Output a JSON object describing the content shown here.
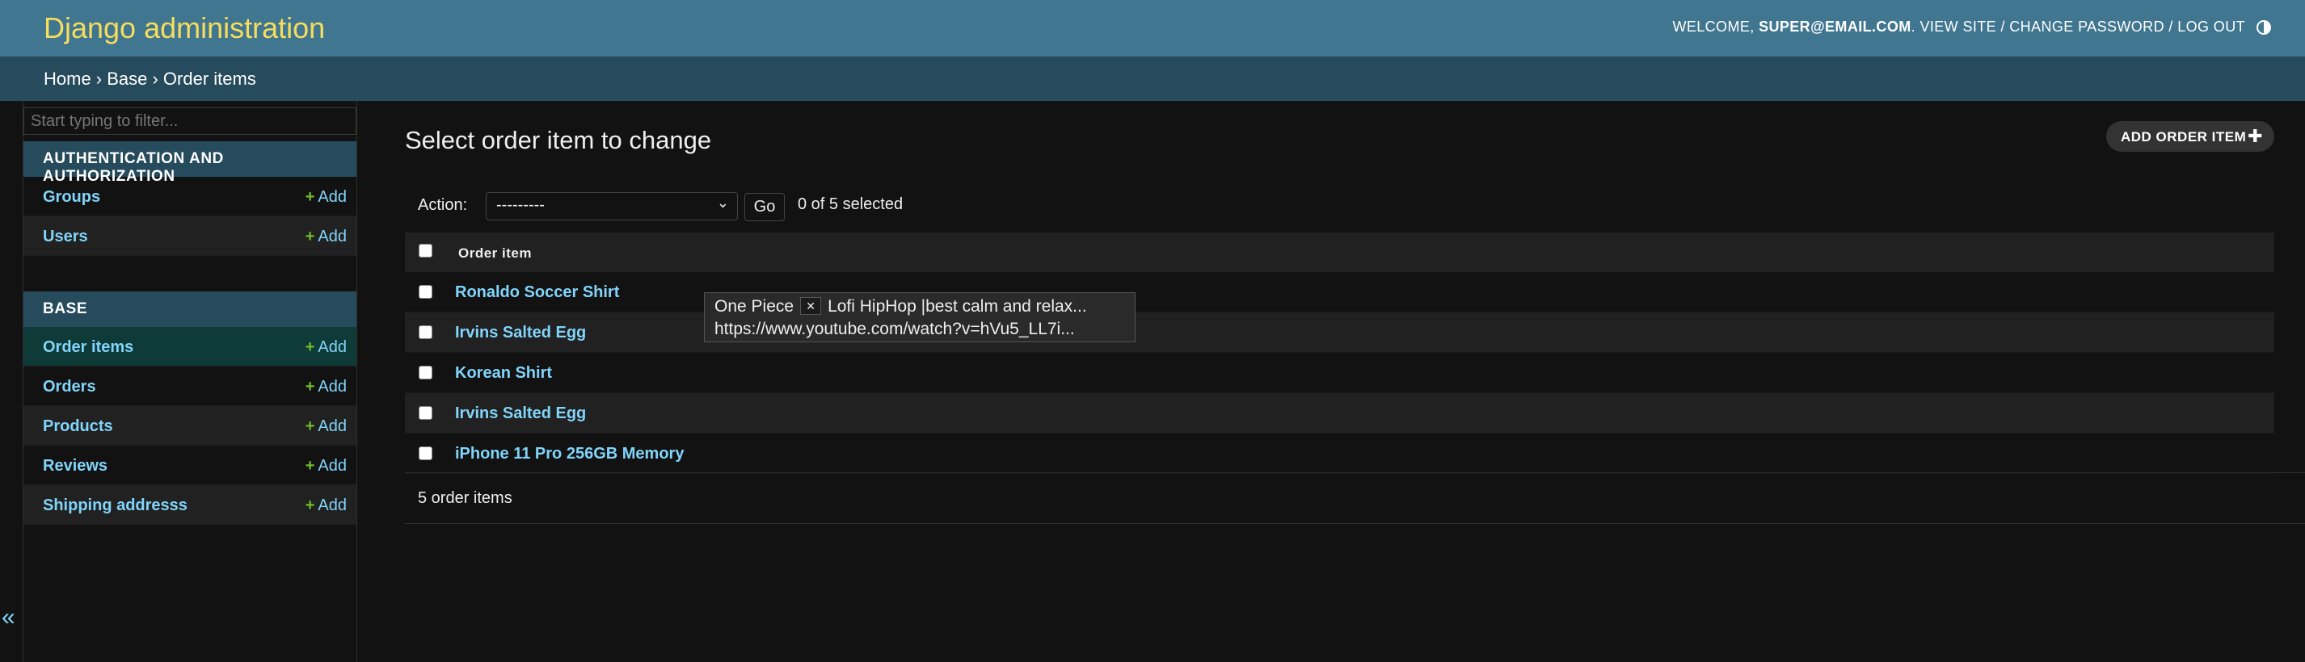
{
  "header": {
    "site_title": "Django administration",
    "welcome": "Welcome,",
    "user_email": "super@email.com",
    "links": [
      "View site",
      "Change password",
      "Log out"
    ],
    "separator": "/"
  },
  "breadcrumbs": {
    "text": "Home › Base › Order items"
  },
  "sidebar": {
    "filter_placeholder": "Start typing to filter...",
    "modules": [
      {
        "caption": "Authentication and Authorization",
        "models": [
          {
            "name": "Groups",
            "add": "Add"
          },
          {
            "name": "Users",
            "add": "Add"
          }
        ]
      },
      {
        "caption": "Base",
        "models": [
          {
            "name": "Order items",
            "add": "Add"
          },
          {
            "name": "Orders",
            "add": "Add"
          },
          {
            "name": "Products",
            "add": "Add"
          },
          {
            "name": "Reviews",
            "add": "Add"
          },
          {
            "name": "Shipping addresss",
            "add": "Add"
          }
        ]
      }
    ],
    "collapse_glyph": "«"
  },
  "content": {
    "title": "Select order item to change",
    "add_button": "Add order item",
    "actions_label": "Action:",
    "action_selected": "---------",
    "go_label": "Go",
    "selection_count": "0 of 5 selected",
    "column_header": "Order item",
    "rows": [
      "Ronaldo Soccer Shirt",
      "Irvins Salted Egg",
      "Korean Shirt",
      "Irvins Salted Egg",
      "iPhone 11 Pro 256GB Memory"
    ],
    "paginator": "5 order items"
  },
  "tooltip": {
    "title_left": "One Piece",
    "title_right": "Lofi HipHop |best calm and relax...",
    "url": "https://www.youtube.com/watch?v=hVu5_LL7i..."
  },
  "icons": {
    "theme": "half-moon-icon",
    "plus": "plus-icon",
    "chevron": "chevron-down-icon"
  },
  "colors": {
    "header_bg": "#417690",
    "title_yellow": "#f5dd5d",
    "breadcrumb_bg": "#264b5d",
    "link": "#81d4fa",
    "add_green": "#70bf2b",
    "page_bg": "#121212"
  }
}
